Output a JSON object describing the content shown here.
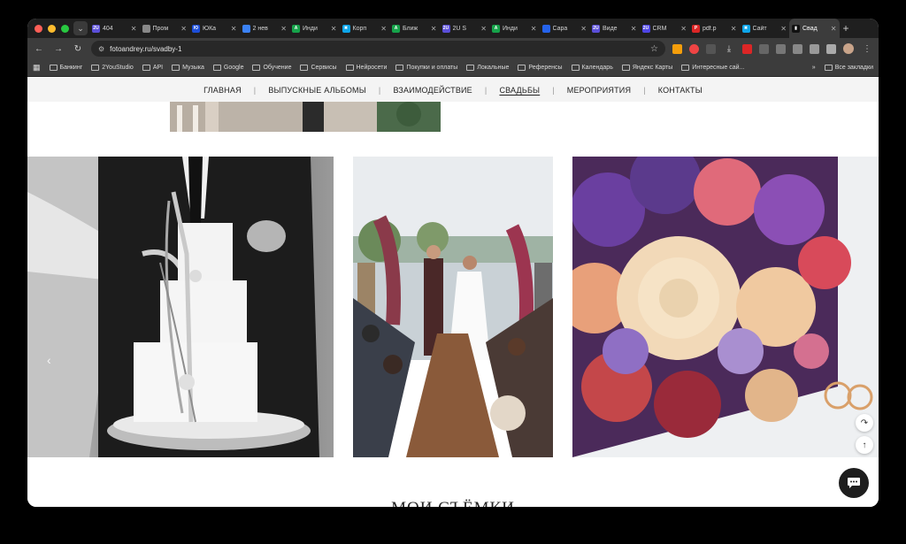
{
  "tabs": [
    {
      "title": "404",
      "fav": "2U",
      "color": "#5b4fd8"
    },
    {
      "title": "Пром",
      "fav": "",
      "color": "#888888"
    },
    {
      "title": "ЮКа",
      "fav": "Ю",
      "color": "#1d4ed8"
    },
    {
      "title": "2 нев",
      "fav": "",
      "color": "#3b82f6"
    },
    {
      "title": "Инди",
      "fav": "A",
      "color": "#16a34a"
    },
    {
      "title": "Корп",
      "fav": "✖",
      "color": "#0ea5e9"
    },
    {
      "title": "Ближ",
      "fav": "A",
      "color": "#16a34a"
    },
    {
      "title": "2U S",
      "fav": "2U",
      "color": "#5b4fd8"
    },
    {
      "title": "Инди",
      "fav": "A",
      "color": "#16a34a"
    },
    {
      "title": "Сара",
      "fav": "",
      "color": "#2563eb"
    },
    {
      "title": "Виде",
      "fav": "2U",
      "color": "#5b4fd8"
    },
    {
      "title": "CRM",
      "fav": "2U",
      "color": "#4f46e5"
    },
    {
      "title": "pdf.p",
      "fav": "P",
      "color": "#dc2626"
    },
    {
      "title": "Сайт",
      "fav": "✖",
      "color": "#0ea5e9"
    },
    {
      "title": "Свад",
      "fav": "▮",
      "color": "#111111",
      "active": true
    }
  ],
  "address": {
    "url": "fotoandrey.ru/svadby-1"
  },
  "bookmarks": {
    "items": [
      "Банкинг",
      "2YouStudio",
      "API",
      "Музыка",
      "Google",
      "Обучение",
      "Сервисы",
      "Нейросети",
      "Покупки и оплаты",
      "Локальные",
      "Референсы",
      "Календарь",
      "Яндекс Карты",
      "Интересные сай..."
    ],
    "more": "»",
    "all": "Все закладки"
  },
  "site": {
    "nav": [
      "ГЛАВНАЯ",
      "ВЫПУСКНЫЕ АЛЬБОМЫ",
      "ВЗАИМОДЕЙСТВИЕ",
      "СВАДЬБЫ",
      "МЕРОПРИЯТИЯ",
      "КОНТАКТЫ"
    ],
    "current": "СВАДЬБЫ",
    "section_title": "МОИ СЪЁМКИ"
  },
  "colors": {
    "tabbar": "#1f1f1f",
    "toolbar": "#3c3c3c",
    "accent": "#1e1e1e"
  }
}
